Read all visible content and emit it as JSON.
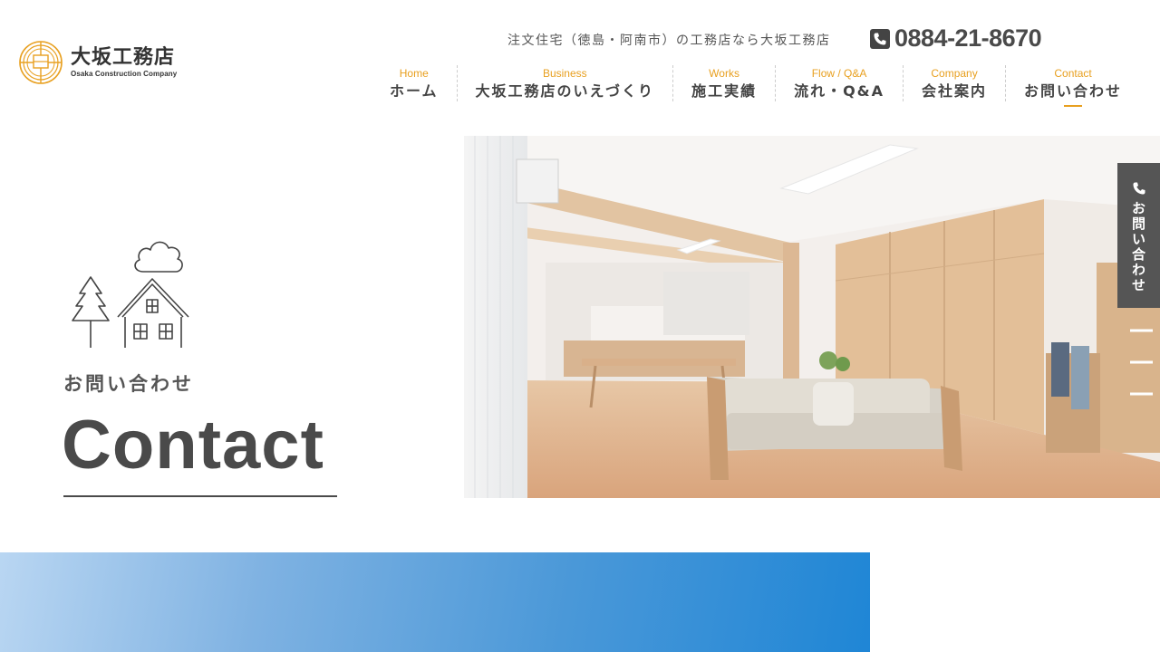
{
  "header": {
    "logo_jp": "大坂工務店",
    "logo_en": "Osaka Construction Company",
    "tagline": "注文住宅（徳島・阿南市）の工務店なら大坂工務店",
    "phone": "0884-21-8670"
  },
  "nav": [
    {
      "en": "Home",
      "jp": "ホーム"
    },
    {
      "en": "Business",
      "jp": "大坂工務店のいえづくり"
    },
    {
      "en": "Works",
      "jp": "施工実績"
    },
    {
      "en": "Flow / Q&A",
      "jp": "流れ・Q&A"
    },
    {
      "en": "Company",
      "jp": "会社案内"
    },
    {
      "en": "Contact",
      "jp": "お問い合わせ"
    }
  ],
  "hero": {
    "title_jp": "お問い合わせ",
    "title_en": "Contact"
  },
  "side_tab": {
    "label": "お問い合わせ"
  },
  "colors": {
    "accent": "#e8a020",
    "text": "#444444",
    "side_tab_bg": "#555555",
    "band_blue": "#1f86d6"
  }
}
